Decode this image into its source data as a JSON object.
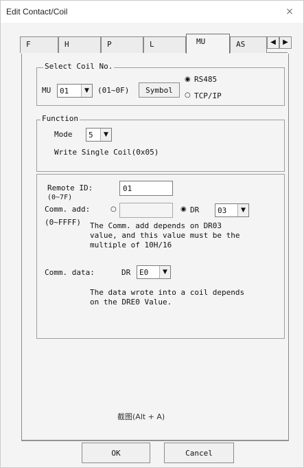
{
  "window": {
    "title": "Edit Contact/Coil",
    "close_label": "×"
  },
  "tabs": [
    {
      "label": "F",
      "active": false
    },
    {
      "label": "H",
      "active": false
    },
    {
      "label": "P",
      "active": false
    },
    {
      "label": "L",
      "active": false
    },
    {
      "label": "MU",
      "active": true
    },
    {
      "label": "AS",
      "active": false
    }
  ],
  "tab_scroll": {
    "left": "◀",
    "right": "▶"
  },
  "select_coil": {
    "legend": "Select Coil No.",
    "prefix": "MU",
    "value": "01",
    "range": "(01~0F)",
    "symbol_button": "Symbol",
    "options": [
      {
        "label": "RS485",
        "checked": true
      },
      {
        "label": "TCP/IP",
        "checked": false
      }
    ]
  },
  "function": {
    "legend": "Function",
    "mode_label": "Mode",
    "mode_value": "5",
    "description": "Write Single Coil(0x05)"
  },
  "params": {
    "remote_id_label": "Remote ID:",
    "remote_id_range": "(0~7F)",
    "remote_id_value": "01",
    "comm_add_label": "Comm. add:",
    "comm_add_range": "(0~FFFF)",
    "comm_add_value": "",
    "dr_label": "DR",
    "dr_value": "03",
    "comm_add_note": [
      "The Comm. add depends on DR03",
      "value, and this value must be the",
      "multiple of 10H/16"
    ],
    "comm_data_label": "Comm. data:",
    "comm_data_dr_label": "DR",
    "comm_data_value": "E0",
    "comm_data_note": [
      "The data wrote into a coil depends",
      "on the DRE0 Value."
    ]
  },
  "capture_hint": "截图(Alt + A)",
  "buttons": {
    "ok": "OK",
    "cancel": "Cancel"
  }
}
